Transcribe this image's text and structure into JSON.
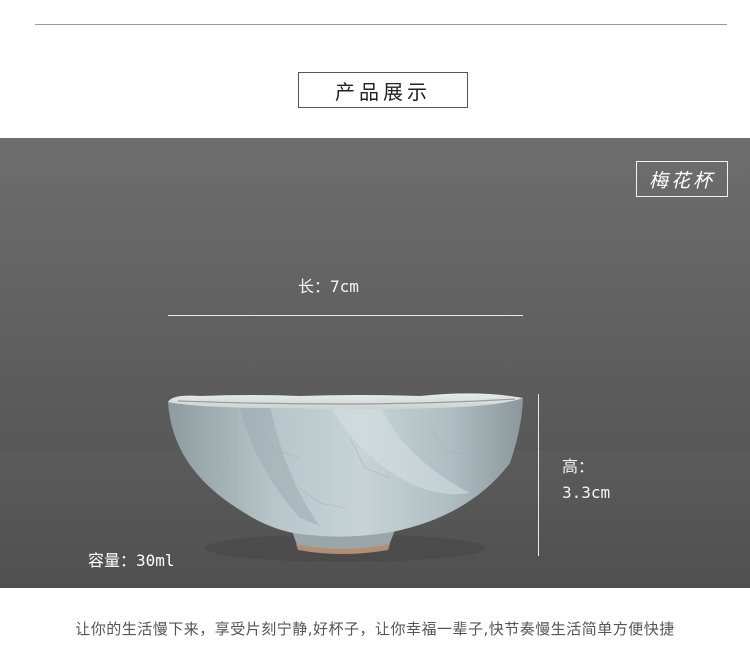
{
  "header": {
    "section_title": "产品展示"
  },
  "photo": {
    "name_tag": "梅花杯",
    "length_label": "长：7cm",
    "height_label_line1": "高：",
    "height_label_line2": "3.3cm",
    "capacity_label": "容量：30ml"
  },
  "footer": {
    "tagline": "让你的生活慢下来，享受片刻宁静,好杯子，让你幸福一辈子,快节奏慢生活简单方便快捷"
  },
  "colors": {
    "backdrop": "#606060",
    "table": "#5a5a5a",
    "cup_glaze": "#b7c5c8",
    "text_light": "#f4f4f4"
  }
}
